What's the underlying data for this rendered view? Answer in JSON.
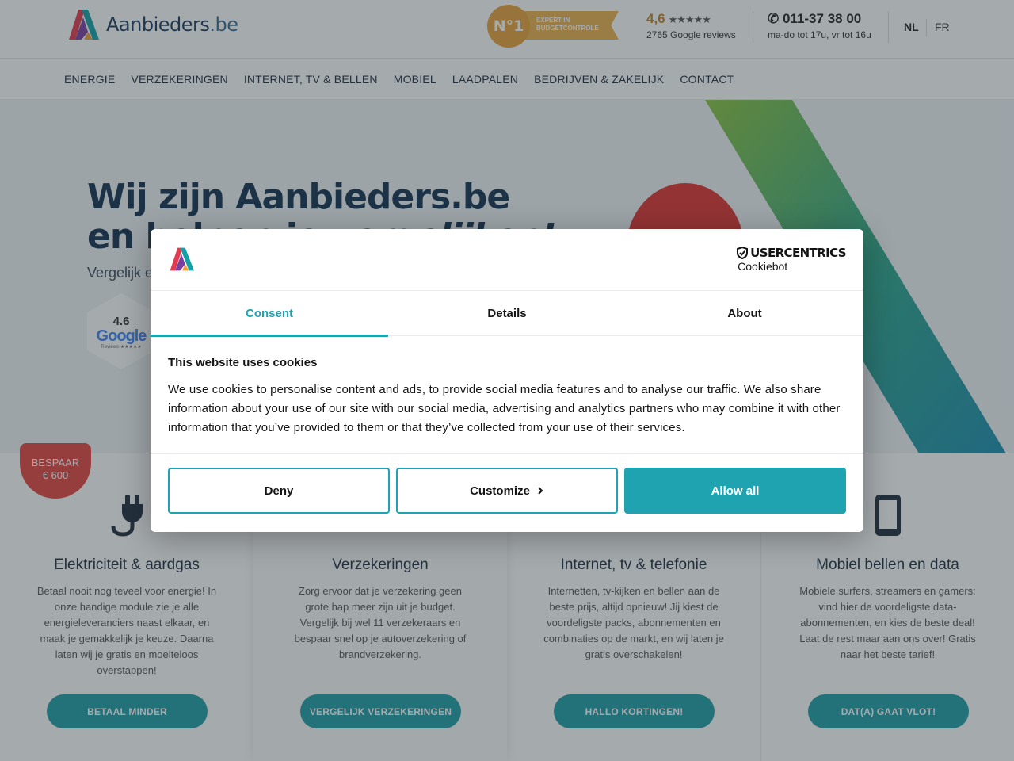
{
  "header": {
    "logo_text": "Aanbieders",
    "logo_tld": ".be",
    "badge": {
      "rank": "N°1",
      "line1": "Expert in",
      "line2": "budgetcontrole"
    },
    "rating": {
      "score": "4,6",
      "stars": "★★★★★",
      "reviews": "2765 Google reviews"
    },
    "phone": {
      "number": "011-37 38 00",
      "hours": "ma-do tot 17u, vr tot 16u"
    },
    "languages": [
      "NL",
      "FR"
    ]
  },
  "nav": {
    "items": [
      "ENERGIE",
      "VERZEKERINGEN",
      "INTERNET, TV & BELLEN",
      "MOBIEL",
      "LAADPALEN",
      "BEDRIJVEN & ZAKELIJK",
      "CONTACT"
    ]
  },
  "hero": {
    "title_line1": "Wij zijn Aanbieders.be",
    "title_line2_plain": "en helpen je ",
    "title_line2_italic": "vergelijken!",
    "subtitle": "Vergelijk e",
    "google": {
      "score": "4.6",
      "brand": "Google",
      "label": "Reviews ★★★★★"
    }
  },
  "save_badge": {
    "line1": "BESPAAR",
    "line2": "€ 600"
  },
  "cards": [
    {
      "icon": "plug-icon",
      "title": "Elektriciteit & aardgas",
      "text": "Betaal nooit nog teveel voor energie! In onze handige module zie je alle energieleveranciers naast elkaar, en maak je gemakkelijk je keuze. Daarna laten wij je gratis en moeiteloos overstappen!",
      "button": "BETAAL MINDER"
    },
    {
      "icon": "umbrella-icon",
      "title": "Verzekeringen",
      "text": "Zorg ervoor dat je verzekering geen grote hap meer zijn uit je budget. Vergelijk bij wel 11 verzekeraars en bespaar snel op je autoverzekering of brandverzekering.",
      "button": "VERGELIJK VERZEKERINGEN"
    },
    {
      "icon": "tv-icon",
      "title": "Internet, tv & telefonie",
      "text": "Internetten, tv-kijken en bellen aan de beste prijs, altijd opnieuw! Jij kiest de voordeligste packs, abonnementen en combinaties op de markt, en wij laten je gratis overschakelen!",
      "button": "HALLO KORTINGEN!"
    },
    {
      "icon": "mobile-phone-icon",
      "title": "Mobiel bellen en data",
      "text": "Mobiele surfers, streamers en gamers: vind hier de voordeligste data-abonnementen, en kies de beste deal! Laat de rest maar aan ons over! Gratis naar het beste tarief!",
      "button": "DAT(A) GAAT VLOT!"
    }
  ],
  "cookie_dialog": {
    "brand_top": "USERCENTRICS",
    "brand_bottom": "Cookiebot",
    "tabs": [
      "Consent",
      "Details",
      "About"
    ],
    "active_tab": "Consent",
    "title": "This website uses cookies",
    "text": "We use cookies to personalise content and ads, to provide social media features and to analyse our traffic. We also share information about your use of our site with our social media, advertising and analytics partners who may combine it with other information that you’ve provided to them or that they’ve collected from your use of their services.",
    "buttons": {
      "deny": "Deny",
      "customize": "Customize",
      "allow": "Allow all"
    }
  },
  "colors": {
    "accent": "#1fa3b0",
    "card_button": "#1f9da6",
    "brand_navy": "#14314f",
    "save_badge": "#e3463e"
  }
}
